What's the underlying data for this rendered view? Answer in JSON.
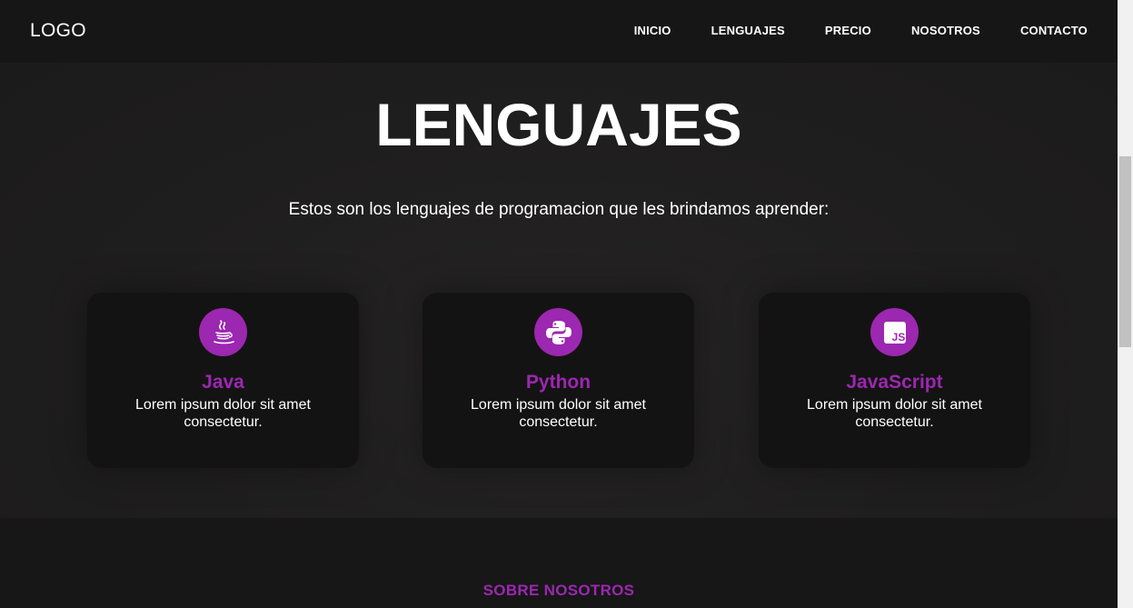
{
  "navbar": {
    "logo": "LOGO",
    "links": [
      {
        "label": "INICIO"
      },
      {
        "label": "LENGUAJES"
      },
      {
        "label": "PRECIO"
      },
      {
        "label": "NOSOTROS"
      },
      {
        "label": "CONTACTO"
      }
    ]
  },
  "hero": {
    "title": "LENGUAJES",
    "subtitle": "Estos son los lenguajes de programacion que les brindamos aprender:"
  },
  "cards": [
    {
      "icon": "java-icon",
      "title": "Java",
      "text": "Lorem ipsum dolor sit amet consectetur."
    },
    {
      "icon": "python-icon",
      "title": "Python",
      "text": "Lorem ipsum dolor sit amet consectetur."
    },
    {
      "icon": "javascript-icon",
      "title": "JavaScript",
      "text": "Lorem ipsum dolor sit amet consectetur."
    }
  ],
  "about": {
    "title": "SOBRE NOSOTROS"
  },
  "colors": {
    "accent": "#9c27b0",
    "navbar_bg": "#161616",
    "card_bg": "#141313"
  }
}
